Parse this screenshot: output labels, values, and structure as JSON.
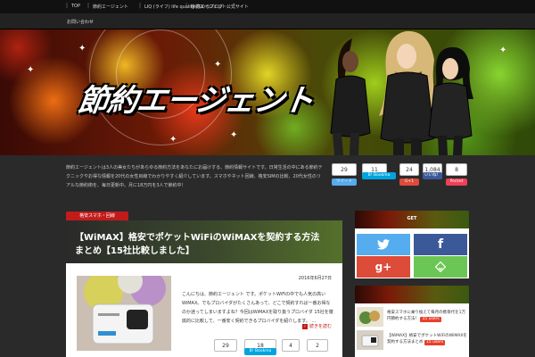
{
  "topnav": {
    "items": [
      "TOP",
      "節約エージェント",
      "LIQ (ライフ) life quality 高めるブログ",
      "節約エージェント公式サイト"
    ]
  },
  "subnav": {
    "item": "お問い合わせ"
  },
  "banner": {
    "title": "節約エージェント"
  },
  "description": "節約エージェントは3人の美女たちがあらゆる節約方法をあなたにお届けする、節約情報サイトです。日常生活の中にある節約テクニックやお得な情報を20代の女性目線でわかりやすく紹介しています。スマホやネット回線、格安SIMの比較、20代女性のリアルな節約術を、毎日更新中。月に18万円を3人で節約中！",
  "header_share": {
    "counts": [
      "29",
      "11",
      "24",
      "1,084",
      "8"
    ],
    "labels": [
      "ツイート",
      "B! Bookma",
      "G+1",
      "いいね！",
      "Pocket"
    ]
  },
  "article": {
    "category": "格安スマホ・回線",
    "title": "【WiMAX】格安でポケットWiFiのWiMAXを契約する方法まとめ【15社比較しました】",
    "date": "2016年6月27日",
    "excerpt": "こんにちは、節約エージェント です。ポケットWiFiの中でも人気の高いWiMAX。でもプロバイダがたくさんあって、どこで契約すれば一番お得なのか迷ってしまいますよね？今回はWiMAXを取り扱うプロバイダ 15社を徹底的に比較して、一番安く契約できるプロバイダを紹介します。 ...",
    "more": "続きを読む",
    "share_counts": [
      "29",
      "18",
      "4",
      "2"
    ],
    "share_labels": [
      "B! Bookma"
    ]
  },
  "sidebar": {
    "follow_title": "GET",
    "social": [
      "twitter-icon",
      "facebook-icon",
      "googleplus-icon",
      "feedly-icon"
    ],
    "ranking": [
      {
        "text": "格安スマホに乗り換えて毎月の携帯代を1万円節約する方法！",
        "users": "15 users"
      },
      {
        "text": "【WiMAX】格安でポケットWiFiのWiMAXを契約する方法まとめ",
        "users": "15 users"
      }
    ]
  },
  "colors": {
    "accent": "#c21b1b",
    "twitter": "#55acee",
    "facebook": "#3b5998",
    "googleplus": "#dd4b39",
    "feedly": "#6cc655"
  }
}
